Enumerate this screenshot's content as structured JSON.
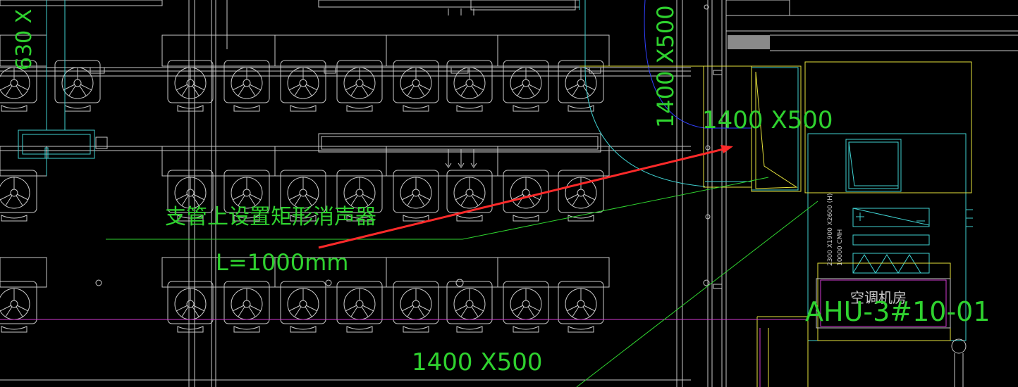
{
  "colors": {
    "background": "#000000",
    "white_lines": "#c8c8c8",
    "cyan": "#3fd0d0",
    "green": "#2fd22f",
    "yellow": "#e6e23c",
    "magenta": "#d23ad2",
    "red": "#ff2a2a",
    "blue": "#3040ff",
    "gray_block": "#8a8a8a"
  },
  "labels": {
    "dim_top_left_vertical": "630 X",
    "dim_top_right_vertical": "1400 X500",
    "dim_upper_right": "1400 X500",
    "note_line1": "支管上设置矩形消声器",
    "note_line2": "L=1000mm",
    "dim_bottom": "1400 X500",
    "room_label": "空调机房",
    "ahu_tag": "AHU-3#10-01",
    "equip_spec_line1": "2300 X1900 X2600 (H)",
    "equip_spec_line2": "10000 CMH"
  },
  "icons": {
    "seat": "office-chair-icon",
    "filter_plus": "plus-icon",
    "filter_minus": "minus-icon",
    "arrow": "leader-arrow-icon"
  }
}
